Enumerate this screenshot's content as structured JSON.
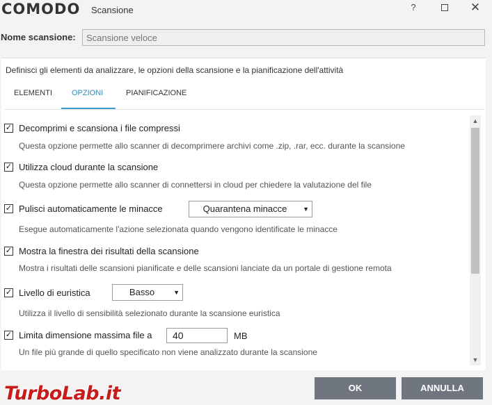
{
  "window": {
    "logo_text": "COMODO",
    "title": "Scansione",
    "help_glyph": "?",
    "close_glyph": "✕"
  },
  "scan_name": {
    "label": "Nome scansione:",
    "placeholder": "Scansione veloce"
  },
  "panel": {
    "description": "Definisci gli elementi da analizzare, le opzioni della scansione e la pianificazione dell'attività"
  },
  "tabs": [
    {
      "label": "ELEMENTI",
      "active": false
    },
    {
      "label": "OPZIONI",
      "active": true
    },
    {
      "label": "PIANIFICAZIONE",
      "active": false
    }
  ],
  "options": [
    {
      "label": "Decomprimi e scansiona i file compressi",
      "description": "Questa opzione permette allo scanner di decomprimere archivi come .zip, .rar, ecc. durante la scansione",
      "checked": true
    },
    {
      "label": "Utilizza cloud durante la scansione",
      "description": "Questa opzione permette allo scanner di connettersi in cloud per chiedere la valutazione del file",
      "checked": true
    },
    {
      "label": "Pulisci automaticamente le minacce",
      "description": "Esegue automaticamente l'azione selezionata quando vengono identificate le minacce",
      "checked": true,
      "select_value": "Quarantena minacce"
    },
    {
      "label": "Mostra la finestra dei risultati della scansione",
      "description": "Mostra i risultati delle scansioni pianificate e delle scansioni lanciate da un portale di gestione remota",
      "checked": true
    },
    {
      "label": "Livello di euristica",
      "description": "Utilizza il livello di sensibilità selezionato durante la scansione euristica",
      "checked": true,
      "select_value": "Basso"
    },
    {
      "label": "Limita dimensione massima file a",
      "description": "Un file più grande di quello specificato non viene analizzato durante la scansione",
      "checked": true,
      "input_value": "40",
      "unit": "MB"
    }
  ],
  "check_glyph": "✓",
  "dropdown_glyph": "▼",
  "scroll": {
    "up_glyph": "▲",
    "down_glyph": "▼"
  },
  "buttons": {
    "ok": "OK",
    "cancel": "ANNULLA"
  },
  "watermark": "TurboLab.it",
  "colors": {
    "accent": "#3ba0d0",
    "button": "#707680",
    "watermark": "#c61c1c"
  }
}
